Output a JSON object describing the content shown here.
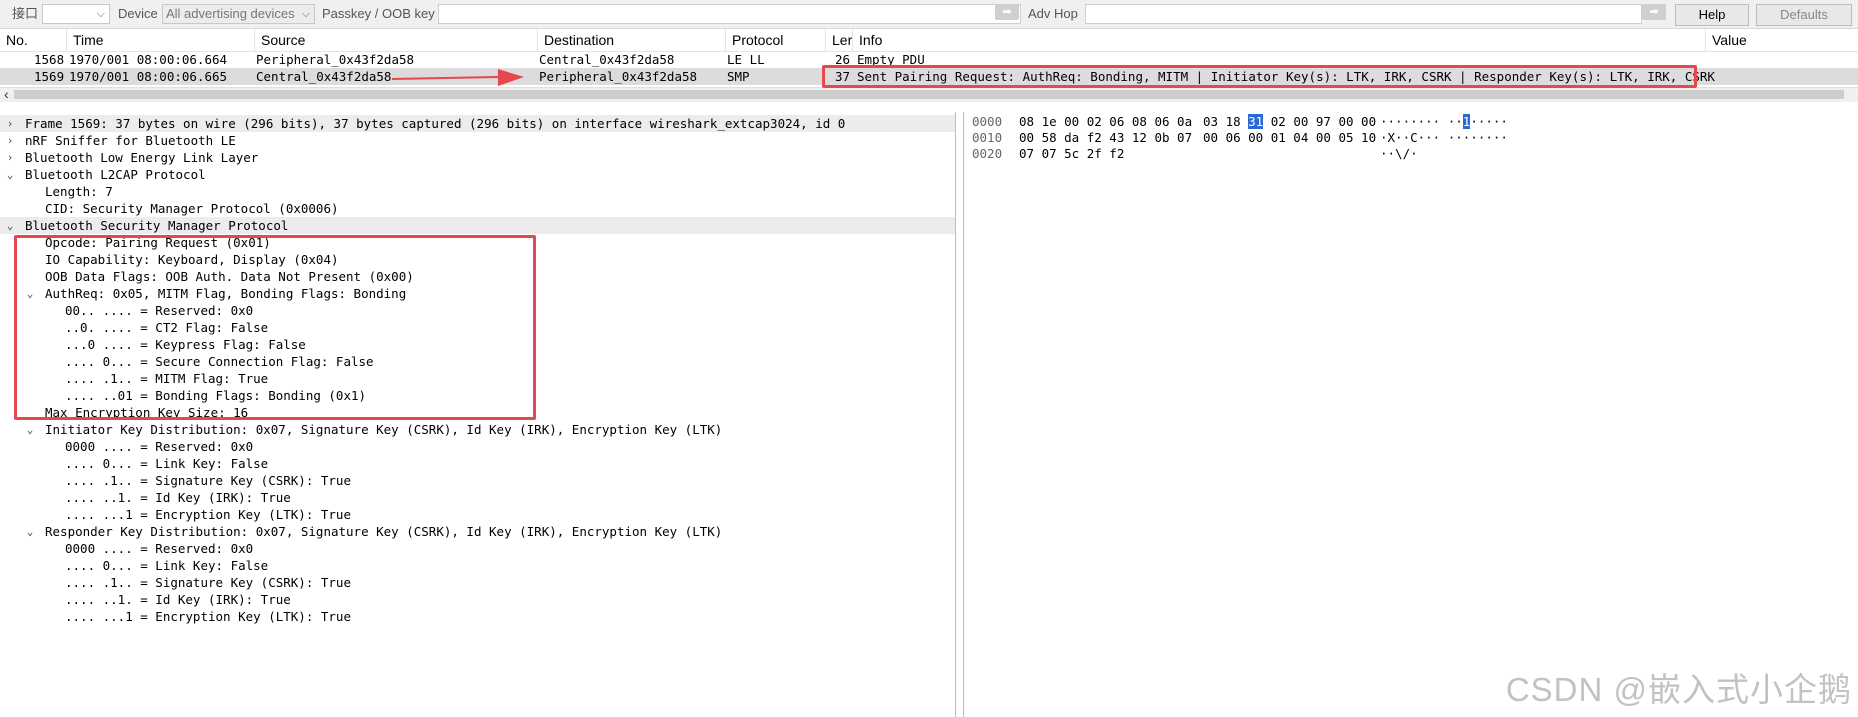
{
  "toolbar": {
    "interface_label": "接口",
    "interface_value": "",
    "device_label": "Device",
    "device_value": "All advertising devices",
    "passkey_label": "Passkey / OOB key",
    "adv_hop_label": "Adv Hop",
    "help_label": "Help",
    "defaults_label": "Defaults"
  },
  "packet_list": {
    "columns": [
      "No.",
      "Time",
      "Source",
      "Destination",
      "Protocol",
      "Ler",
      "Info",
      "Value"
    ],
    "rows": [
      {
        "no": "1568",
        "time": "1970/001 08:00:06.664",
        "source": "Peripheral_0x43f2da58",
        "destination": "Central_0x43f2da58",
        "protocol": "LE LL",
        "length": "26",
        "info": "Empty PDU"
      },
      {
        "no": "1569",
        "time": "1970/001 08:00:06.665",
        "source": "Central_0x43f2da58",
        "destination": "Peripheral_0x43f2da58",
        "protocol": "SMP",
        "length": "37",
        "info": "Sent Pairing Request: AuthReq: Bonding, MITM | Initiator Key(s): LTK, IRK, CSRK | Responder Key(s): LTK, IRK, CSRK"
      }
    ]
  },
  "details": [
    {
      "toggle": "›",
      "text": "Frame 1569: 37 bytes on wire (296 bits), 37 bytes captured (296 bits) on interface wireshark_extcap3024, id 0"
    },
    {
      "toggle": "›",
      "text": "nRF Sniffer for Bluetooth LE"
    },
    {
      "toggle": "›",
      "text": "Bluetooth Low Energy Link Layer"
    },
    {
      "toggle": "⌄",
      "text": "Bluetooth L2CAP Protocol"
    },
    {
      "toggle": "",
      "text": "Length: 7"
    },
    {
      "toggle": "",
      "text": "CID: Security Manager Protocol (0x0006)"
    },
    {
      "toggle": "⌄",
      "text": "Bluetooth Security Manager Protocol"
    },
    {
      "toggle": "",
      "text": "Opcode: Pairing Request (0x01)"
    },
    {
      "toggle": "",
      "text": "IO Capability: Keyboard, Display (0x04)"
    },
    {
      "toggle": "",
      "text": "OOB Data Flags: OOB Auth. Data Not Present (0x00)"
    },
    {
      "toggle": "⌄",
      "text": "AuthReq: 0x05, MITM Flag, Bonding Flags: Bonding"
    },
    {
      "toggle": "",
      "text": "00.. .... = Reserved: 0x0"
    },
    {
      "toggle": "",
      "text": "..0. .... = CT2 Flag: False"
    },
    {
      "toggle": "",
      "text": "...0 .... = Keypress Flag: False"
    },
    {
      "toggle": "",
      "text": ".... 0... = Secure Connection Flag: False"
    },
    {
      "toggle": "",
      "text": ".... .1.. = MITM Flag: True"
    },
    {
      "toggle": "",
      "text": ".... ..01 = Bonding Flags: Bonding (0x1)"
    },
    {
      "toggle": "",
      "text": "Max Encryption Key Size: 16"
    },
    {
      "toggle": "⌄",
      "text": "Initiator Key Distribution: 0x07, Signature Key (CSRK), Id Key (IRK), Encryption Key (LTK)"
    },
    {
      "toggle": "",
      "text": "0000 .... = Reserved: 0x0"
    },
    {
      "toggle": "",
      "text": ".... 0... = Link Key: False"
    },
    {
      "toggle": "",
      "text": ".... .1.. = Signature Key (CSRK): True"
    },
    {
      "toggle": "",
      "text": ".... ..1. = Id Key (IRK): True"
    },
    {
      "toggle": "",
      "text": ".... ...1 = Encryption Key (LTK): True"
    },
    {
      "toggle": "⌄",
      "text": "Responder Key Distribution: 0x07, Signature Key (CSRK), Id Key (IRK), Encryption Key (LTK)"
    },
    {
      "toggle": "",
      "text": "0000 .... = Reserved: 0x0"
    },
    {
      "toggle": "",
      "text": ".... 0... = Link Key: False"
    },
    {
      "toggle": "",
      "text": ".... .1.. = Signature Key (CSRK): True"
    },
    {
      "toggle": "",
      "text": ".... ..1. = Id Key (IRK): True"
    },
    {
      "toggle": "",
      "text": ".... ...1 = Encryption Key (LTK): True"
    }
  ],
  "bytes": [
    {
      "offset": "0000",
      "hex_a": "08 1e 00 02 06 08 06 0a",
      "hex_b1": "03 18 ",
      "hex_hl": "31",
      "hex_b2": " 02 00 97 00 00",
      "ascii_a": "········ ··",
      "ascii_hl": "1",
      "ascii_b": "·····"
    },
    {
      "offset": "0010",
      "hex_a": "00 58 da f2 43 12 0b 07",
      "hex_b1": "00 06 00 01 04 00 05 10",
      "hex_hl": "",
      "hex_b2": "",
      "ascii_a": "·X··C··· ········",
      "ascii_hl": "",
      "ascii_b": ""
    },
    {
      "offset": "0020",
      "hex_a": "07 07 5c 2f f2",
      "hex_b1": "",
      "hex_hl": "",
      "hex_b2": "",
      "ascii_a": "··\\/·",
      "ascii_hl": "",
      "ascii_b": ""
    }
  ],
  "colors": {
    "annotation_red": "#e5484d",
    "byte_highlight": "#2a6ad4",
    "selected_row": "#dcdcdc"
  },
  "watermark": "CSDN @嵌入式小企鹅"
}
